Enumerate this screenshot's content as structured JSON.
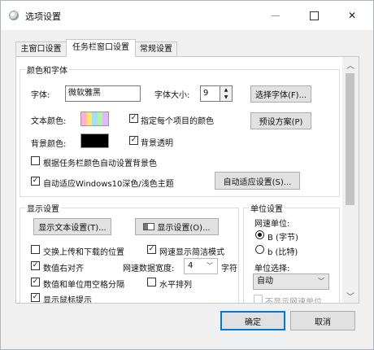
{
  "window": {
    "title": "选项设置",
    "minimize": "—",
    "maximize": "☐",
    "close": "✕"
  },
  "tabs": [
    {
      "label": "主窗口设置",
      "active": false
    },
    {
      "label": "任务栏窗口设置",
      "active": true
    },
    {
      "label": "常规设置",
      "active": false
    }
  ],
  "color_font": {
    "legend": "颜色和字体",
    "font_label": "字体:",
    "font_value": "微软雅黑",
    "font_size_label": "字体大小:",
    "font_size_value": "9",
    "choose_font_button": "选择字体(F)...",
    "text_color_label": "文本颜色:",
    "text_color_swatch": [
      "#ffb3d1",
      "#ffe566",
      "#9fe0ff",
      "#b5f0a8",
      "#e0b8ff"
    ],
    "specify_color_label": "指定每个项目的颜色",
    "specify_color_checked": true,
    "preset_button": "预设方案(P)",
    "bg_color_label": "背景颜色:",
    "bg_color_value": "#000000",
    "bg_transparent_label": "背景透明",
    "bg_transparent_checked": true,
    "auto_bg_label": "根据任务栏颜色自动设置背景色",
    "auto_bg_checked": false,
    "win10_theme_label": "自动适应Windows10深色/浅色主题",
    "win10_theme_checked": true,
    "auto_adapt_button": "自动适应设置(S)..."
  },
  "display": {
    "legend": "显示设置",
    "text_settings_button": "显示文本设置(T)...",
    "display_settings_button": "显示设置(O)...",
    "swap_label": "交换上传和下载的位置",
    "swap_checked": false,
    "concise_label": "网速显示简洁模式",
    "concise_checked": true,
    "right_align_label": "数值右对齐",
    "right_align_checked": true,
    "width_label": "网速数据宽度:",
    "width_value": "4",
    "width_unit": "字符",
    "space_label": "数值和单位用空格分隔",
    "space_checked": true,
    "horizontal_label": "水平排列",
    "horizontal_checked": false,
    "mouse_tip_label": "显示鼠标提示",
    "mouse_tip_checked": true
  },
  "unit": {
    "legend": "单位设置",
    "speed_unit_label": "网速单位:",
    "options": [
      "B (字节)",
      "b (比特)"
    ],
    "selected": 0,
    "unit_select_label": "单位选择:",
    "unit_select_value": "自动",
    "hide_unit_label": "不显示网速单位"
  },
  "footer": {
    "ok": "确定",
    "cancel": "取消"
  }
}
